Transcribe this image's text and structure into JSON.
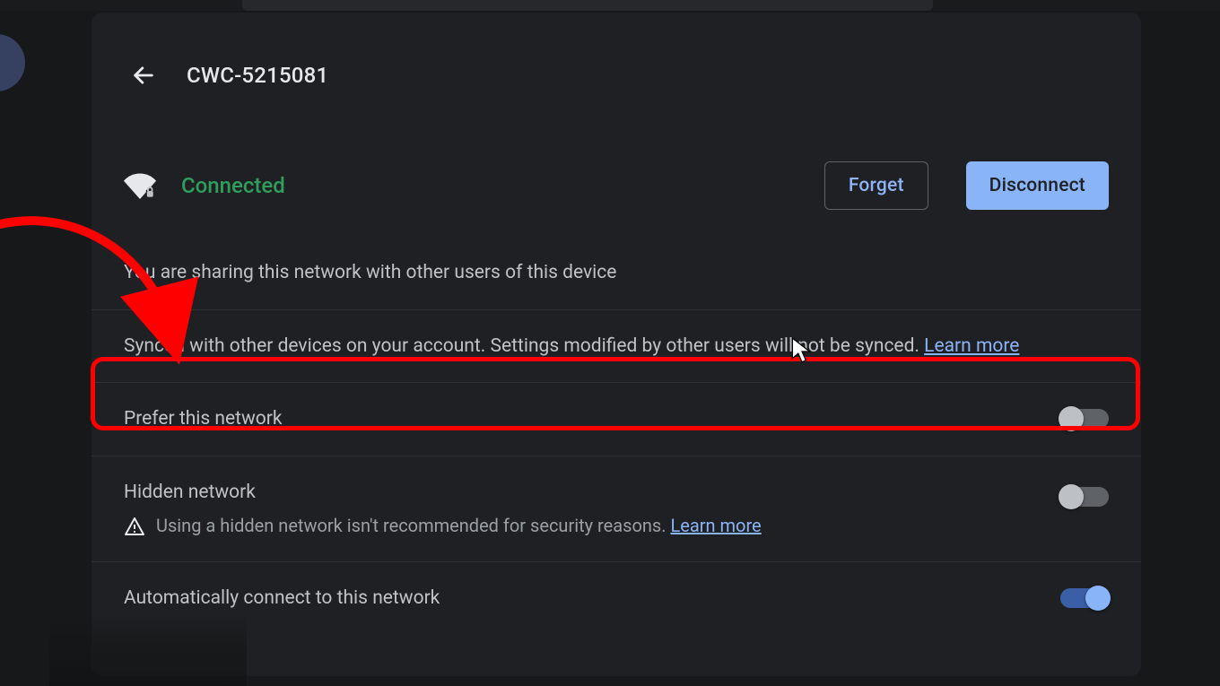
{
  "header": {
    "network_name": "CWC-5215081"
  },
  "status": {
    "label": "Connected",
    "forget_label": "Forget",
    "disconnect_label": "Disconnect"
  },
  "rows": {
    "sharing_text": "You are sharing this network with other users of this device",
    "sync_text_before": "Synced with other devices on your account. Settings modified by other users will not be synced. ",
    "sync_learn_more": "Learn more",
    "prefer_label": "Prefer this network",
    "hidden_label": "Hidden network",
    "hidden_sub_before": "Using a hidden network isn't recommended for security reasons.  ",
    "hidden_learn_more": "Learn more",
    "auto_connect_label": "Automatically connect to this network"
  },
  "toggles": {
    "prefer": false,
    "hidden": false,
    "auto_connect": true
  },
  "colors": {
    "panel_bg": "#1f2023",
    "accent": "#8ab4f8",
    "connected_green": "#2f9e5d",
    "annotation_red": "#ff0000"
  }
}
